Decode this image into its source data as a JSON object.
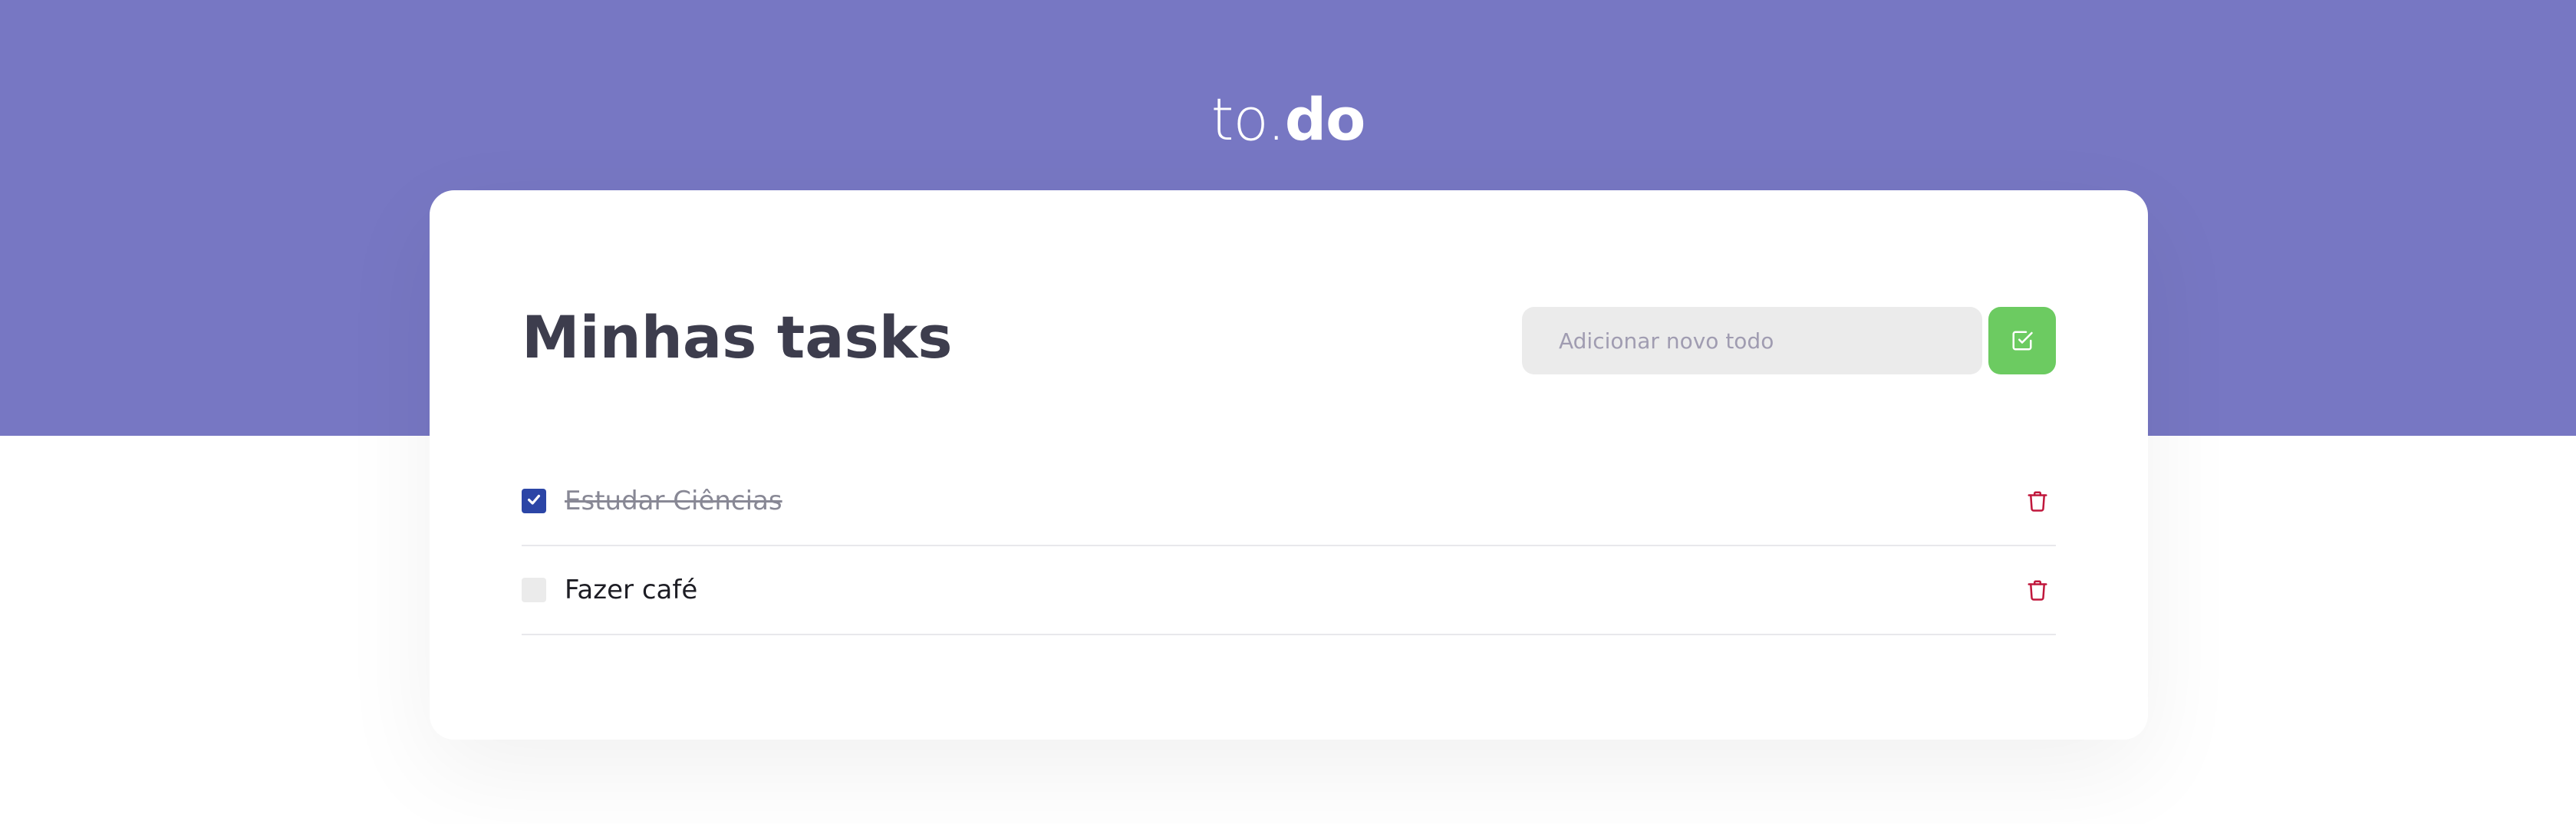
{
  "header": {
    "logo_light": "to.",
    "logo_bold": "do"
  },
  "main": {
    "title": "Minhas tasks",
    "new_todo": {
      "placeholder": "Adicionar novo todo",
      "value": ""
    }
  },
  "tasks": [
    {
      "title": "Estudar Ciências",
      "done": true
    },
    {
      "title": "Fazer café",
      "done": false
    }
  ],
  "icons": {
    "add": "check-square-icon",
    "checkbox_checked": "check-icon",
    "delete": "trash-icon"
  },
  "colors": {
    "header_background": "#7777c3",
    "add_button": "#6ccb61",
    "checkbox_checked": "#2b45a6",
    "delete_icon": "#c0173c",
    "title_text": "#3d3d4d"
  }
}
